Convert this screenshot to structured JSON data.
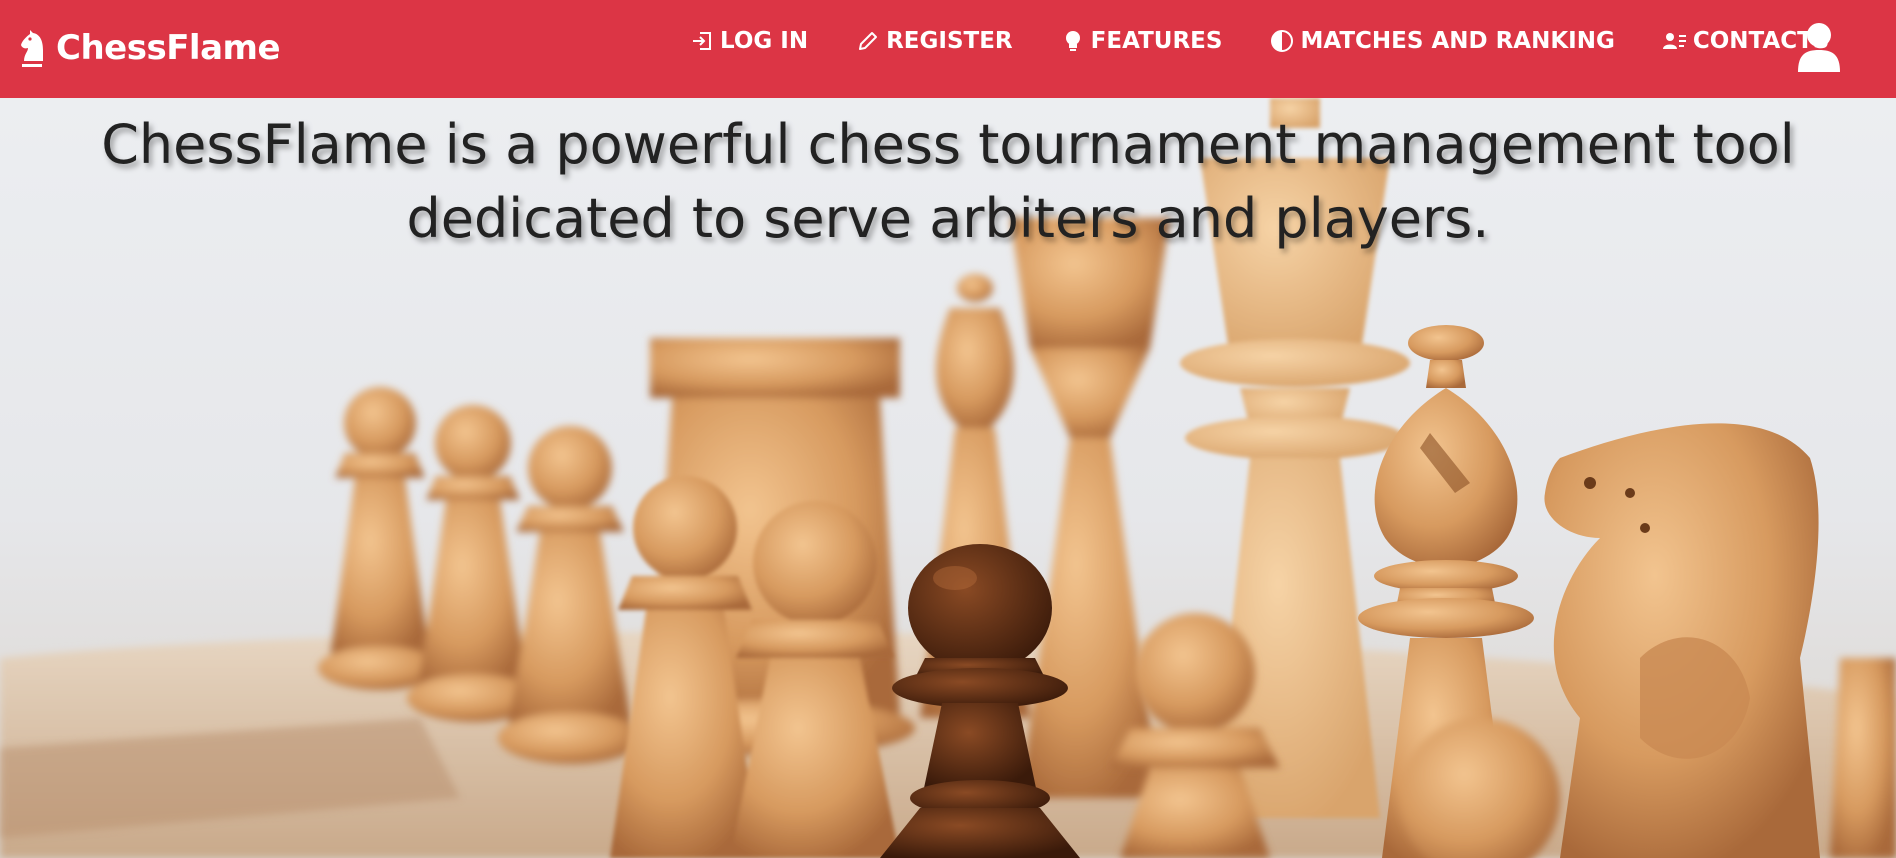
{
  "app": {
    "brand_name": "ChessFlame",
    "brand_icon": "chess-knight-icon",
    "accent_color": "#dc3545"
  },
  "nav": {
    "items": [
      {
        "label": "LOG IN",
        "icon": "login-icon"
      },
      {
        "label": "REGISTER",
        "icon": "pencil-icon"
      },
      {
        "label": "FEATURES",
        "icon": "lightbulb-icon"
      },
      {
        "label": "MATCHES AND RANKING",
        "icon": "half-circle-icon"
      },
      {
        "label": "CONTACTS",
        "icon": "contact-list-icon"
      }
    ],
    "user_icon": "user-icon"
  },
  "hero": {
    "headline": "ChessFlame is a powerful chess tournament management tool dedicated to serve arbiters and players.",
    "background_image": "chess-pieces-photo"
  }
}
